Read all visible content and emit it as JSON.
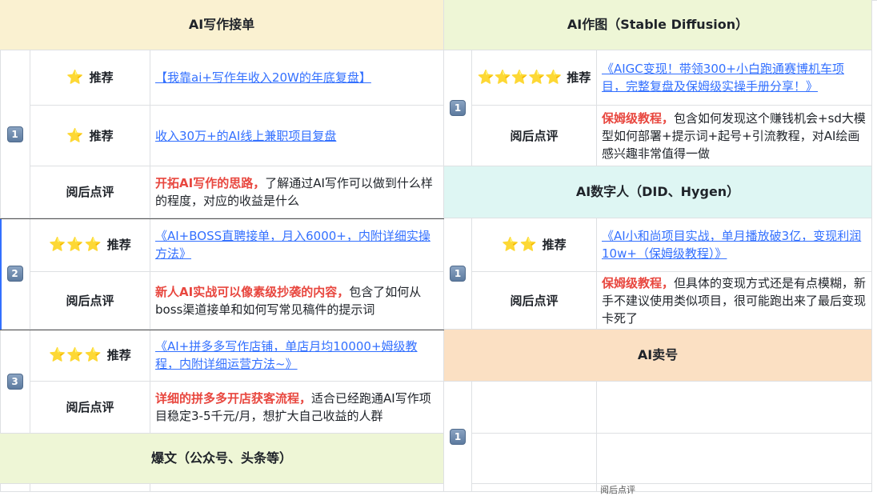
{
  "left": {
    "section1_title": "AI写作接单",
    "badge1": "1",
    "row1": {
      "tag": "推荐",
      "stars": "⭐",
      "link": "【我靠ai+写作年收入20W的年底复盘】"
    },
    "row2": {
      "tag": "推荐",
      "stars": "⭐",
      "link": "收入30万+的AI线上兼职项目复盘"
    },
    "row3": {
      "label": "阅后点评",
      "highlight": "开拓AI写作的思路，",
      "rest": "了解通过AI写作可以做到什么样的程度，对应的收益是什么"
    },
    "badge2": "2",
    "row4": {
      "tag": "推荐",
      "stars": "⭐⭐⭐",
      "link": "《AI+BOSS直聘接单，月入6000+，内附详细实操方法》"
    },
    "row5": {
      "label": "阅后点评",
      "highlight": "新人AI实战可以像素级抄袭的内容，",
      "rest": "包含了如何从boss渠道接单和如何写常见稿件的提示词"
    },
    "badge3": "3",
    "row6": {
      "tag": "推荐",
      "stars": "⭐⭐⭐",
      "link": "《AI+拼多多写作店铺，单店月均10000+姆级教程，内附详细运营方法~》"
    },
    "row7": {
      "label": "阅后点评",
      "highlight": "详细的拼多多开店获客流程，",
      "rest": "适合已经跑通AI写作项目稳定3-5千元/月，想扩大自己收益的人群"
    },
    "section2_title": "爆文（公众号、头条等）"
  },
  "right": {
    "section1_title": "AI作图（Stable Diffusion）",
    "badge1": "1",
    "row1": {
      "tag": "推荐",
      "stars": "⭐⭐⭐⭐⭐",
      "link": "《AIGC变现！带领300+小白跑通赛博机车项目，完整复盘及保姆级实操手册分享！》"
    },
    "row2": {
      "label": "阅后点评",
      "highlight": "保姆级教程，",
      "rest": "包含如何发现这个赚钱机会+sd大模型如何部署+提示词+起号+引流教程，对AI绘画感兴趣非常值得一做"
    },
    "section2_title": "AI数字人（DID、Hygen）",
    "badge2": "1",
    "row3": {
      "tag": "推荐",
      "stars": "⭐⭐",
      "link": "《AI小和尚项目实战，单月播放破3亿，变现利润10w+（保姆级教程）》"
    },
    "row4": {
      "label": "阅后点评",
      "highlight": "保姆级教程，",
      "rest": "但具体的变现方式还是有点模糊，新手不建议使用类似项目，很可能跑出来了最后变现卡死了"
    },
    "section3_title": "AI卖号",
    "badge3": "1",
    "bottom_clip": "阅后点评"
  },
  "colors": {
    "header_yellow": "#faf1d1",
    "header_green": "#eef6d6",
    "header_cyan": "#def6f3",
    "header_orange": "#fbe0c3",
    "link": "#3370ff",
    "highlight_red": "#e8473f"
  }
}
